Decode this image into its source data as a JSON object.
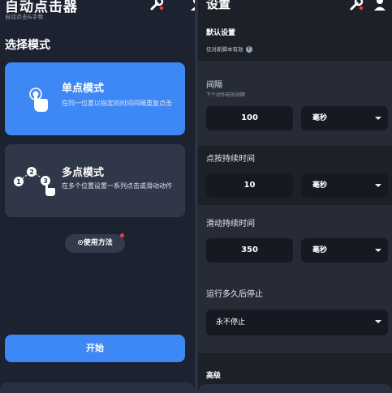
{
  "left": {
    "app_title": "自动点击器",
    "app_subtitle": "自动点击&手势",
    "section_title": "选择模式",
    "modes": [
      {
        "title": "单点模式",
        "desc": "在同一位置以指定的时间间隔重复点击"
      },
      {
        "title": "多点模式",
        "desc": "在多个位置设置一系列点击或滑动动作"
      }
    ],
    "howto_label": "使用方法",
    "start_label": "开始"
  },
  "right": {
    "title": "设置",
    "default_section": "默认设置",
    "default_note": "仅对新脚本有效",
    "interval": {
      "label": "间隔",
      "sublabel": "下个动作前的间隔",
      "value": "100",
      "unit": "毫秒"
    },
    "press": {
      "label": "点按持续时间",
      "value": "10",
      "unit": "毫秒"
    },
    "swipe": {
      "label": "滑动持续时间",
      "value": "350",
      "unit": "毫秒"
    },
    "stop": {
      "label": "运行多久后停止",
      "value": "永不停止"
    },
    "advanced_section": "高级"
  },
  "colors": {
    "accent": "#3e88f5",
    "panel_bg": "#1c2230",
    "card_bg": "#2f3748",
    "notification": "#ff3344"
  },
  "icons": [
    "tools-icon",
    "user-icon",
    "tap-hand-icon",
    "multi-tap-icon",
    "help-circle-icon",
    "chevron-down-icon"
  ]
}
